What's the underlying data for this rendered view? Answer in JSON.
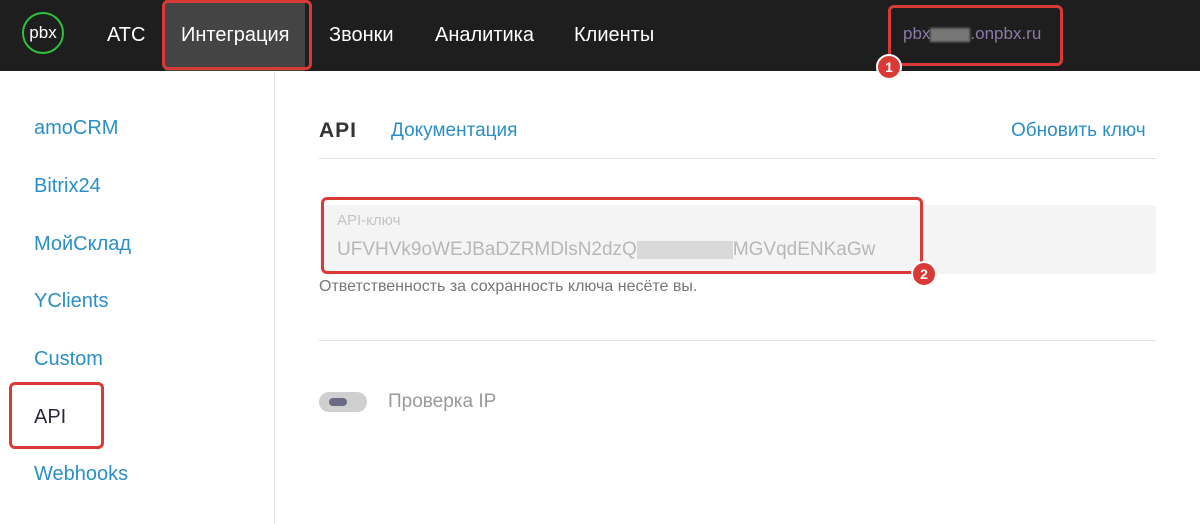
{
  "header": {
    "logo_text": "pbx",
    "nav": [
      {
        "label": "АТС"
      },
      {
        "label": "Интеграция"
      },
      {
        "label": "Звонки"
      },
      {
        "label": "Аналитика"
      },
      {
        "label": "Клиенты"
      }
    ],
    "domain_prefix": "pbx",
    "domain_suffix": ".onpbx.ru"
  },
  "sidebar": {
    "items": [
      {
        "label": "amoCRM"
      },
      {
        "label": "Bitrix24"
      },
      {
        "label": "МойСклад"
      },
      {
        "label": "YClients"
      },
      {
        "label": "Custom"
      },
      {
        "label": "API"
      },
      {
        "label": "Webhooks"
      }
    ]
  },
  "main": {
    "title": "API",
    "docs_link": "Документация",
    "refresh_link": "Обновить ключ",
    "key_label": "API-ключ",
    "key_prefix": "UFVHVk9oWEJBaDZRMDlsN2dzQ",
    "key_suffix": "MGVqdENKaGw",
    "key_hint": "Ответственность за сохранность ключа несёте вы.",
    "ip_check_label": "Проверка IP"
  },
  "annotations": {
    "badge_1": "1",
    "badge_2": "2"
  },
  "colors": {
    "topbar": "#1e1e1e",
    "accent_link": "#2a8fc8",
    "highlight": "#d93a36",
    "logo_ring": "#2ec13b"
  }
}
